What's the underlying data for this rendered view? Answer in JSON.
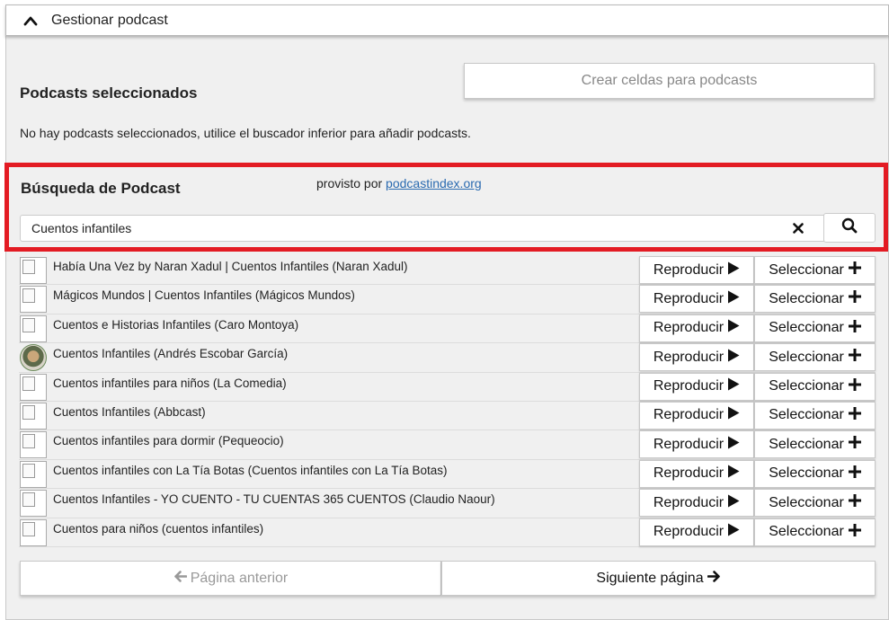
{
  "header": {
    "title": "Gestionar podcast",
    "icon": "chevron-up-icon"
  },
  "selected": {
    "title": "Podcasts seleccionados",
    "create_button": "Crear celdas para podcasts",
    "empty_message": "No hay podcasts seleccionados, utilice el buscador inferior para añadir podcasts."
  },
  "search": {
    "title": "Búsqueda de Podcast",
    "provided_by": "provisto por",
    "provider_link": "podcastindex.org",
    "query": "Cuentos infantiles",
    "highlight_color": "#e31b23"
  },
  "results": [
    {
      "label": "Había Una Vez by Naran Xadul | Cuentos Infantiles (Naran Xadul)",
      "thumb": "broken"
    },
    {
      "label": "Mágicos Mundos | Cuentos Infantiles (Mágicos Mundos)",
      "thumb": "broken"
    },
    {
      "label": "Cuentos e Historias Infantiles (Caro Montoya)",
      "thumb": "broken"
    },
    {
      "label": "Cuentos Infantiles (Andrés Escobar García)",
      "thumb": "photo"
    },
    {
      "label": "Cuentos infantiles para niños (La Comedia)",
      "thumb": "broken"
    },
    {
      "label": "Cuentos Infantiles (Abbcast)",
      "thumb": "broken"
    },
    {
      "label": "Cuentos infantiles para dormir (Pequeocio)",
      "thumb": "broken"
    },
    {
      "label": "Cuentos infantiles con La Tía Botas (Cuentos infantiles con La Tía Botas)",
      "thumb": "broken"
    },
    {
      "label": "Cuentos Infantiles - YO CUENTO - TU CUENTAS 365 CUENTOS (Claudio Naour)",
      "thumb": "broken"
    },
    {
      "label": "Cuentos para niños (cuentos infantiles)",
      "thumb": "broken"
    }
  ],
  "row_actions": {
    "play": "Reproducir",
    "select": "Seleccionar"
  },
  "pagination": {
    "prev": "Página anterior",
    "next": "Siguiente página"
  }
}
